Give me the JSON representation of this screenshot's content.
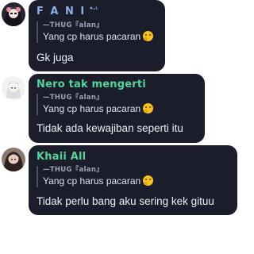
{
  "messages": [
    {
      "author": "F A N I",
      "author_tag": "ᴬ·ᴸ",
      "author_color": "#8fb0e6",
      "reply": {
        "author": "—THUG『alan』",
        "text": "Yang cp harus pacaran",
        "emoji": "thinking-face-icon"
      },
      "text": "Gk juga"
    },
    {
      "author": "Nero tak mengerti",
      "author_color": "#52d49a",
      "reply": {
        "author": "—THUG『alan』",
        "text": "Yang cp harus pacaran",
        "emoji": "thinking-face-icon"
      },
      "text": "Tidak ada kewajiban seperti itu"
    },
    {
      "author": "Khaii All",
      "author_color": "#52d49a",
      "reply": {
        "author": "—THUG『alan』",
        "text": "Yang cp harus pacaran",
        "emoji": "thinking-face-icon"
      },
      "text": "Tidak perlu bang aku sering kek gituu"
    }
  ]
}
